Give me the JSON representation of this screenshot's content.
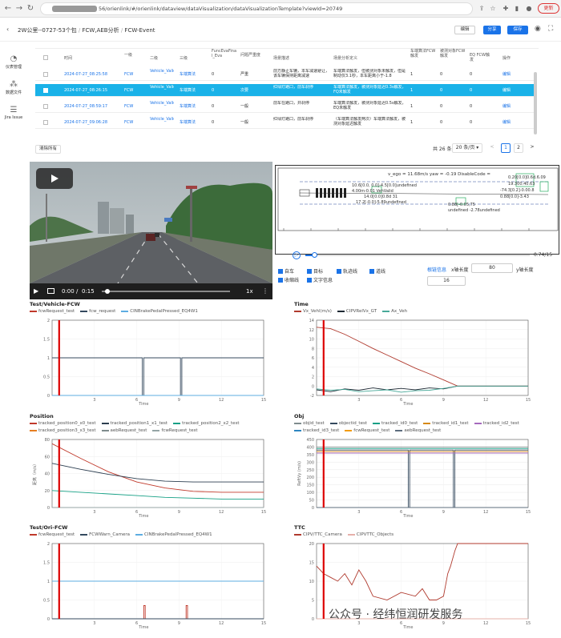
{
  "browser": {
    "url": "56/orienlink/#/orienlink/dataview/dataVisualization/dataVisualizationTemplate?viewId=20749",
    "update_label": "更新"
  },
  "header": {
    "crumbs": [
      "2W公里--0727-53个包",
      "FCW,AEB分析",
      "FCW-Event"
    ],
    "edit_label": "编辑",
    "share_label": "分享",
    "save_label": "保存"
  },
  "sidebar": {
    "items": [
      {
        "label": "仪表管理",
        "icon": "dashboard-icon"
      },
      {
        "label": "数据文件",
        "icon": "data-file-icon"
      },
      {
        "label": "Jira Issue",
        "icon": "jira-icon"
      }
    ]
  },
  "table": {
    "headers": [
      "时间",
      "一级",
      "二级",
      "三级",
      "FuncEvaFinal_Eva",
      "问题严重度",
      "场景描述",
      "场景分析定义",
      "车端算法FCW触发",
      "被测对象FCW触发",
      "EQ FCW触发",
      "操作"
    ],
    "rows": [
      {
        "time": "2024-07-27_08:25:58",
        "l1": "FCW",
        "l2": "Vehicle_Valid",
        "l3": "车端算法",
        "eva": "0",
        "sev": "严重",
        "desc": "前方静止车辆，本车减速避让，该车辆保持距离减速",
        "analysis": "车端算法触发，但被测对象未触发，但是制动仅3.1秒，本车距离小于-1.8",
        "a": "1",
        "b": "0",
        "c": "0",
        "op": "编辑"
      },
      {
        "time": "2024-07-27_08:26:15",
        "l1": "FCW",
        "l2": "Vehicle_Valid",
        "l3": "车端算法",
        "eva": "0",
        "sev": "次要",
        "desc": "红绿灯路口，前车刹停",
        "analysis": "车端算法触发，被测对象延迟0.3s触发，FQ未触发",
        "a": "1",
        "b": "0",
        "c": "0",
        "op": "编辑"
      },
      {
        "time": "2024-07-27_08:59:17",
        "l1": "FCW",
        "l2": "Vehicle_Valid",
        "l3": "车端算法",
        "eva": "0",
        "sev": "一般",
        "desc": "前车在路口，并刹停",
        "analysis": "车端算法触发，被测对象延迟0.5s触发，EQ未触发",
        "a": "1",
        "b": "0",
        "c": "0",
        "op": "编辑"
      },
      {
        "time": "2024-07-27_09:06:28",
        "l1": "FCW",
        "l2": "Vehicle_Valid",
        "l3": "车端算法",
        "eva": "0",
        "sev": "一般",
        "desc": "红绿灯路口，前车刹停",
        "analysis": "（车端算法触发两次）车端算法触发，被测对象延迟触发",
        "a": "1",
        "b": "0",
        "c": "0",
        "op": "编辑"
      }
    ],
    "clear_label": "清除所有"
  },
  "pager": {
    "total": "共 26 条",
    "page_size": "20 条/页",
    "pages": [
      "1",
      "2"
    ],
    "prev": "<",
    "next": ">"
  },
  "video": {
    "time": "0:00",
    "duration": "0:15",
    "speed": "1x"
  },
  "plot": {
    "header_text": "v_ego = 11.68m/s yaw = -0.19 DisableCode = ",
    "labels": [
      "10.6[0.0, 0.0]-4.5[0.0]undefined",
      "4.00m-0.01 VehValid",
      "14.0[0.0]0.8d 31",
      "17.2[-0.0]-5.89undefined",
      "0.20[0.0]0.6d.6.09",
      "19.300.40.63",
      "-74.3[0.2]-0.00.8",
      "0.88[0.0]-3.43",
      "0.88[-0.05,75",
      "undefined -2.78undefined"
    ],
    "progress_text": "0.74/15",
    "progress": 0.04
  },
  "controls": {
    "checks": [
      "自车",
      "目标",
      "轨迹线",
      "道线",
      "收缩线",
      "文字信息"
    ],
    "link_label": "根链信息",
    "xlen_label": "x轴长度",
    "xlen_value": "80",
    "ylen_label": "y轴长度",
    "ylen_value": "16"
  },
  "chart_data": [
    {
      "title": "Test/Vehicle-FCW",
      "type": "line",
      "xlabel": "Time",
      "xlim": [
        0,
        15
      ],
      "ylim": [
        0,
        2
      ],
      "xticks": [
        3,
        6,
        9,
        12,
        15
      ],
      "yticks": [
        0,
        0.5,
        1,
        1.5,
        2
      ],
      "marker_x": 0.5,
      "series": [
        {
          "name": "fcwRequest_test",
          "color": "#c0392b",
          "x": [
            0,
            15
          ],
          "y": [
            0,
            0
          ]
        },
        {
          "name": "fcw_request",
          "color": "#34495e",
          "x": [
            0,
            6.4,
            6.4,
            6.5,
            6.5,
            9.1,
            9.1,
            9.2,
            9.2,
            15
          ],
          "y": [
            1,
            1,
            0,
            0,
            1,
            1,
            0,
            0,
            1,
            1
          ]
        },
        {
          "name": "CINBrakePedalPressed_EQ4W1",
          "color": "#5dade2",
          "x": [
            0,
            15
          ],
          "y": [
            0,
            0
          ]
        }
      ]
    },
    {
      "title": "Time",
      "type": "line",
      "xlabel": "Time",
      "xlim": [
        0,
        15
      ],
      "ylim": [
        -2,
        14
      ],
      "xticks": [
        3,
        6,
        9,
        12,
        15
      ],
      "yticks": [
        -2,
        0,
        2,
        4,
        6,
        8,
        10,
        12,
        14
      ],
      "marker_x": 0.5,
      "series": [
        {
          "name": "Vx_Vehl(m/s)",
          "color": "#b03a2e",
          "x": [
            0,
            1,
            2,
            3,
            4,
            5,
            6,
            7,
            8,
            9,
            10,
            15
          ],
          "y": [
            12.5,
            12.2,
            11,
            9.5,
            8,
            6.6,
            5.2,
            3.8,
            2.6,
            1.3,
            0,
            0
          ]
        },
        {
          "name": "CIPVRelVx_GT",
          "color": "#1c2833",
          "x": [
            0,
            1,
            2,
            3,
            4,
            5,
            6,
            7,
            8,
            9,
            10,
            15
          ],
          "y": [
            -0.8,
            -1.2,
            -0.6,
            -0.9,
            -0.4,
            -0.8,
            -0.5,
            -0.8,
            -0.4,
            -0.6,
            0,
            0
          ]
        },
        {
          "name": "Ax_Veh",
          "color": "#48a999",
          "x": [
            0,
            1,
            2,
            3,
            4,
            5,
            6,
            7,
            8,
            9,
            10,
            15
          ],
          "y": [
            -0.6,
            -0.9,
            -0.7,
            -1.2,
            -1.0,
            -0.8,
            -1.3,
            -1.0,
            -0.9,
            -0.5,
            0,
            0
          ]
        }
      ]
    },
    {
      "title": "Position",
      "type": "line",
      "xlabel": "Time",
      "ylabel": "距离（m/s）",
      "xlim": [
        0,
        15
      ],
      "ylim": [
        0,
        80
      ],
      "xticks": [
        3,
        6,
        9,
        12,
        15
      ],
      "yticks": [
        0,
        20,
        40,
        60,
        80
      ],
      "marker_x": 0.5,
      "series": [
        {
          "name": "tracked_position0_x0_test",
          "color": "#c0392b",
          "x": [
            0,
            2,
            4,
            6,
            8,
            10,
            12,
            15
          ],
          "y": [
            75,
            58,
            42,
            30,
            23,
            19,
            18,
            18
          ]
        },
        {
          "name": "tracked_position1_x1_test",
          "color": "#2c3e50",
          "x": [
            0,
            2,
            4,
            6,
            8,
            10,
            12,
            15
          ],
          "y": [
            52,
            45,
            39,
            34,
            31,
            30,
            30,
            30
          ]
        },
        {
          "name": "tracked_position2_x2_test",
          "color": "#16a085",
          "x": [
            0,
            2,
            4,
            6,
            8,
            10,
            12,
            15
          ],
          "y": [
            20,
            18,
            16,
            14,
            12,
            11,
            10,
            10
          ]
        },
        {
          "name": "tracked_position3_x3_test",
          "color": "#e67e22",
          "x": [
            0,
            15
          ],
          "y": [
            0,
            0
          ]
        },
        {
          "name": "aebRequest_test",
          "color": "#7f8c8d",
          "x": [
            0,
            15
          ],
          "y": [
            0,
            0
          ]
        },
        {
          "name": "fcwRequest_test",
          "color": "#95a5a6",
          "x": [
            0,
            15
          ],
          "y": [
            0,
            0
          ]
        }
      ]
    },
    {
      "title": "Obj",
      "type": "line",
      "xlabel": "Time",
      "ylabel": "ReftVy (m/s)",
      "xlim": [
        0,
        15
      ],
      "ylim": [
        0,
        450
      ],
      "xticks": [
        3,
        6,
        9,
        12,
        15
      ],
      "yticks": [
        0,
        50,
        100,
        150,
        200,
        250,
        300,
        350,
        400,
        450
      ],
      "marker_x": 0.5,
      "series": [
        {
          "name": "objid_test",
          "color": "#7f8c8d",
          "x": [
            0,
            15
          ],
          "y": [
            400,
            400
          ]
        },
        {
          "name": "objectid_test",
          "color": "#34495e",
          "x": [
            0,
            6.5,
            6.5,
            6.6,
            6.6,
            9.7,
            9.7,
            9.8,
            9.8,
            15
          ],
          "y": [
            380,
            380,
            0,
            0,
            380,
            380,
            0,
            0,
            380,
            380
          ]
        },
        {
          "name": "tracked_id0_test",
          "color": "#16a085",
          "x": [
            0,
            15
          ],
          "y": [
            390,
            390
          ]
        },
        {
          "name": "tracked_id1_test",
          "color": "#d68910",
          "x": [
            0,
            15
          ],
          "y": [
            370,
            370
          ]
        },
        {
          "name": "tracked_id2_test",
          "color": "#a569bd",
          "x": [
            0,
            15
          ],
          "y": [
            360,
            360
          ]
        },
        {
          "name": "tracked_id3_test",
          "color": "#2e86c1",
          "x": [
            0,
            15
          ],
          "y": [
            0,
            0
          ]
        },
        {
          "name": "fcwRequest_test",
          "color": "#f39c12",
          "x": [
            0,
            15
          ],
          "y": [
            0,
            0
          ]
        },
        {
          "name": "aebRequest_test",
          "color": "#5d6d7e",
          "x": [
            0,
            15
          ],
          "y": [
            0,
            0
          ]
        }
      ]
    },
    {
      "title": "Test/Ori-FCW",
      "type": "line",
      "xlabel": "Time",
      "xlim": [
        0,
        15
      ],
      "ylim": [
        0,
        2
      ],
      "xticks": [
        3,
        6,
        9,
        12,
        15
      ],
      "yticks": [
        0,
        0.5,
        1,
        1.5,
        2
      ],
      "marker_x": 0.5,
      "series": [
        {
          "name": "fcwRequest_test",
          "color": "#c0392b",
          "x": [
            0,
            6.5,
            6.5,
            6.6,
            6.6,
            9.5,
            9.5,
            9.6,
            9.6,
            15
          ],
          "y": [
            0,
            0,
            0.35,
            0.35,
            0,
            0,
            0.35,
            0.35,
            0,
            0
          ]
        },
        {
          "name": "FCWWarn_Camera",
          "color": "#34495e",
          "x": [
            0,
            15
          ],
          "y": [
            0,
            0
          ]
        },
        {
          "name": "CINBrakePedalPressed_EQ4W1",
          "color": "#5dade2",
          "x": [
            0,
            15
          ],
          "y": [
            1,
            1
          ]
        }
      ]
    },
    {
      "title": "TTC",
      "type": "line",
      "xlabel": "Time",
      "xlim": [
        0,
        15
      ],
      "ylim": [
        0,
        20
      ],
      "xticks": [
        3,
        6,
        9,
        12,
        15
      ],
      "yticks": [
        0,
        5,
        10,
        15,
        20
      ],
      "marker_x": 0.5,
      "series": [
        {
          "name": "CIPV/TTC_Camera",
          "color": "#b03a2e",
          "x": [
            0,
            0.5,
            1,
            1.5,
            2,
            2.5,
            3,
            3.5,
            4,
            5,
            6,
            7,
            7.5,
            8,
            8.5,
            9,
            9.3,
            9.5,
            9.8,
            10,
            15
          ],
          "y": [
            14,
            12,
            11,
            10,
            12,
            9,
            13,
            10,
            6,
            5,
            7,
            6,
            8,
            5,
            5,
            6,
            12,
            14,
            18,
            20,
            20
          ]
        },
        {
          "name": "CIPVTTC_Objects",
          "color": "#e6b0aa",
          "x": [
            0,
            15
          ],
          "y": [
            0,
            0
          ]
        }
      ]
    }
  ],
  "watermark": "公众号 · 经纬恒润研发服务"
}
